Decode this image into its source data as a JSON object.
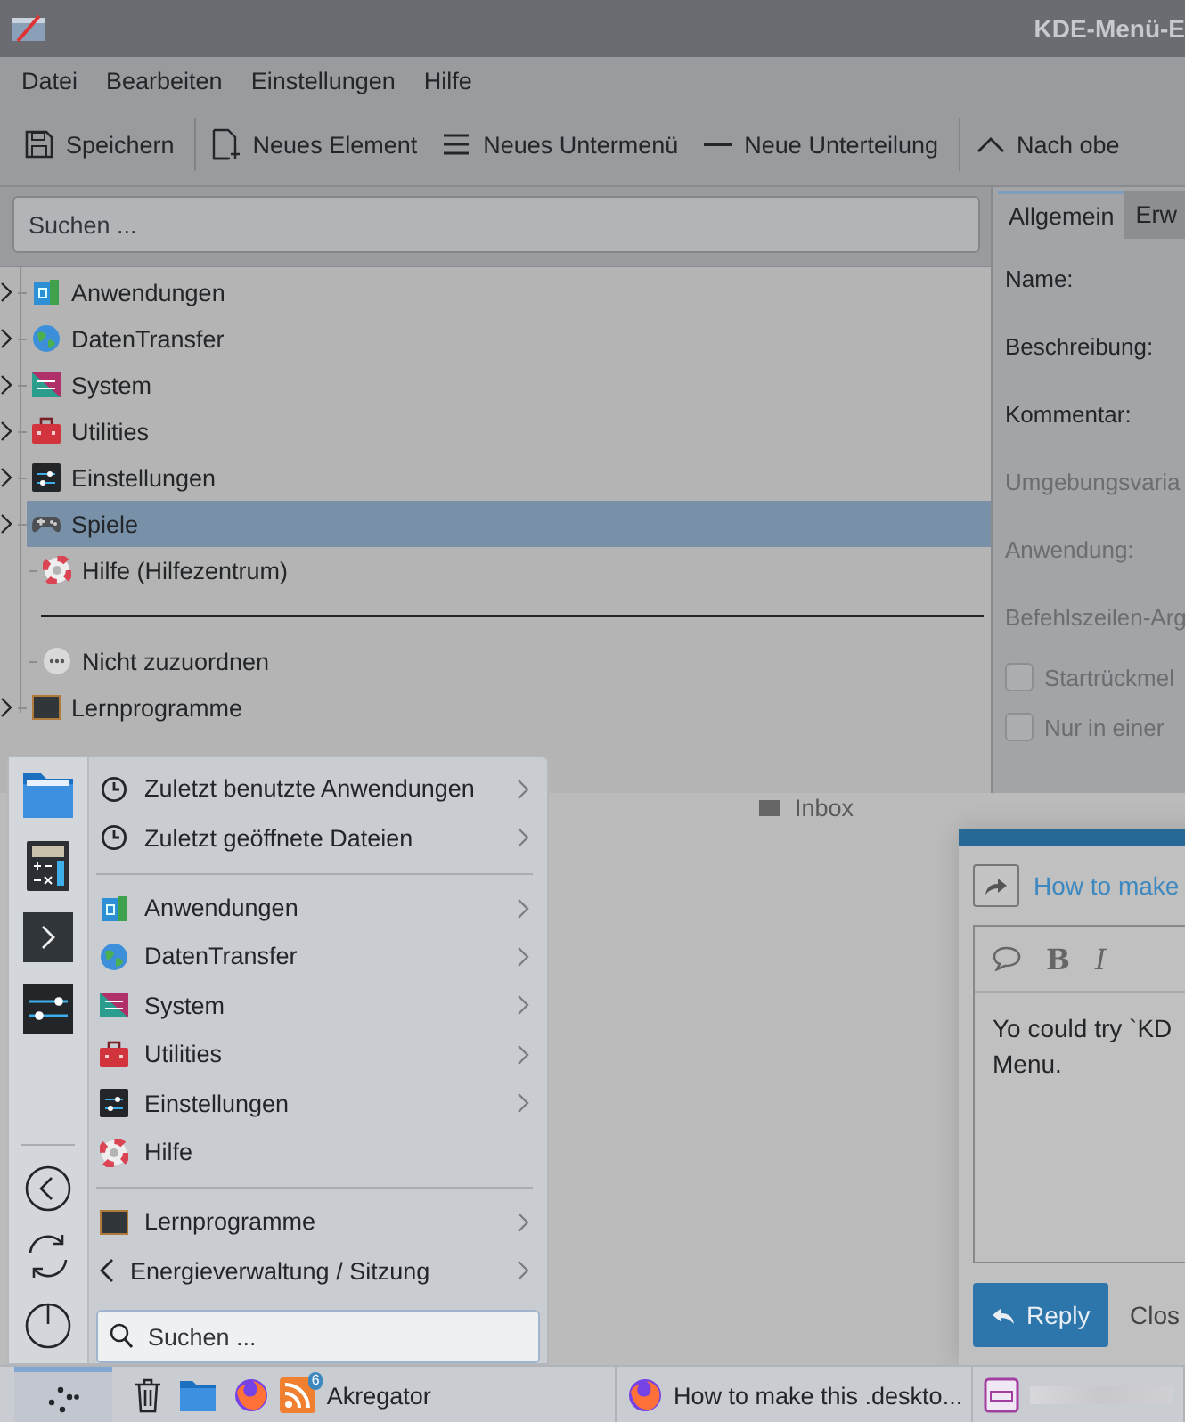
{
  "editor": {
    "title": "KDE-Menü-E",
    "menu": [
      "Datei",
      "Bearbeiten",
      "Einstellungen",
      "Hilfe"
    ],
    "toolbar": [
      {
        "kind": "button",
        "label": "Speichern"
      },
      {
        "kind": "separator"
      },
      {
        "kind": "button",
        "label": "Neues Element"
      },
      {
        "kind": "button",
        "label": "Neues Untermenü"
      },
      {
        "kind": "button",
        "label": "Neue Unterteilung"
      },
      {
        "kind": "separator"
      },
      {
        "kind": "button",
        "label": "Nach obe"
      }
    ],
    "search": {
      "placeholder": "Suchen ..."
    },
    "tree": [
      {
        "kind": "item",
        "label": "Anwendungen",
        "expandable": true,
        "selected": false
      },
      {
        "kind": "item",
        "label": "DatenTransfer",
        "expandable": true,
        "selected": false
      },
      {
        "kind": "item",
        "label": "System",
        "expandable": true,
        "selected": false
      },
      {
        "kind": "item",
        "label": "Utilities",
        "expandable": true,
        "selected": false
      },
      {
        "kind": "item",
        "label": "Einstellungen",
        "expandable": true,
        "selected": false
      },
      {
        "kind": "item",
        "label": "Spiele",
        "expandable": true,
        "selected": true
      },
      {
        "kind": "item",
        "label": "Hilfe (Hilfezentrum)",
        "expandable": false,
        "selected": false
      },
      {
        "kind": "separator"
      },
      {
        "kind": "item",
        "label": "Nicht zuzuordnen",
        "expandable": false,
        "selected": false
      },
      {
        "kind": "item",
        "label": "Lernprogramme",
        "expandable": true,
        "selected": false
      }
    ],
    "tabs": [
      {
        "label": "Allgemein",
        "selected": true
      },
      {
        "label": "Erw",
        "selected": false
      }
    ],
    "fields": [
      {
        "label": "Name:",
        "disabled": false
      },
      {
        "label": "Beschreibung:",
        "disabled": false
      },
      {
        "label": "Kommentar:",
        "disabled": false
      },
      {
        "label": "Umgebungsvaria",
        "disabled": true
      },
      {
        "label": "Anwendung:",
        "disabled": true
      },
      {
        "label": "Befehlszeilen-Arg",
        "disabled": true
      }
    ],
    "checkboxes": [
      {
        "label": "Startrückmel",
        "checked": false,
        "disabled": true
      },
      {
        "label": "Nur in einer",
        "checked": false,
        "disabled": true
      }
    ]
  },
  "desktop": {
    "folder_label": "Inbox"
  },
  "reply_dialog": {
    "link": "How to make",
    "format_buttons": [
      "B",
      "I"
    ],
    "text": "Yo could try `KD",
    "text_2": "Menu.",
    "reply": "Reply",
    "close": "Clos"
  },
  "launcher": {
    "items": [
      {
        "kind": "submenu",
        "label": "Zuletzt benutzte Anwendungen"
      },
      {
        "kind": "submenu",
        "label": "Zuletzt geöffnete Dateien"
      },
      {
        "kind": "separator"
      },
      {
        "kind": "submenu",
        "label": "Anwendungen"
      },
      {
        "kind": "submenu",
        "label": "DatenTransfer"
      },
      {
        "kind": "submenu",
        "label": "System"
      },
      {
        "kind": "submenu",
        "label": "Utilities"
      },
      {
        "kind": "submenu",
        "label": "Einstellungen"
      },
      {
        "kind": "item",
        "label": "Hilfe"
      },
      {
        "kind": "separator"
      },
      {
        "kind": "submenu",
        "label": "Lernprogramme"
      },
      {
        "kind": "submenu",
        "label": "Energieverwaltung / Sitzung"
      }
    ],
    "search": {
      "placeholder": "Suchen ..."
    }
  },
  "taskbar": {
    "tasks": [
      {
        "label": "Akregator",
        "badge": "6"
      },
      {
        "label": "How to make this .deskto..."
      },
      {
        "kind": "blurred"
      }
    ]
  }
}
